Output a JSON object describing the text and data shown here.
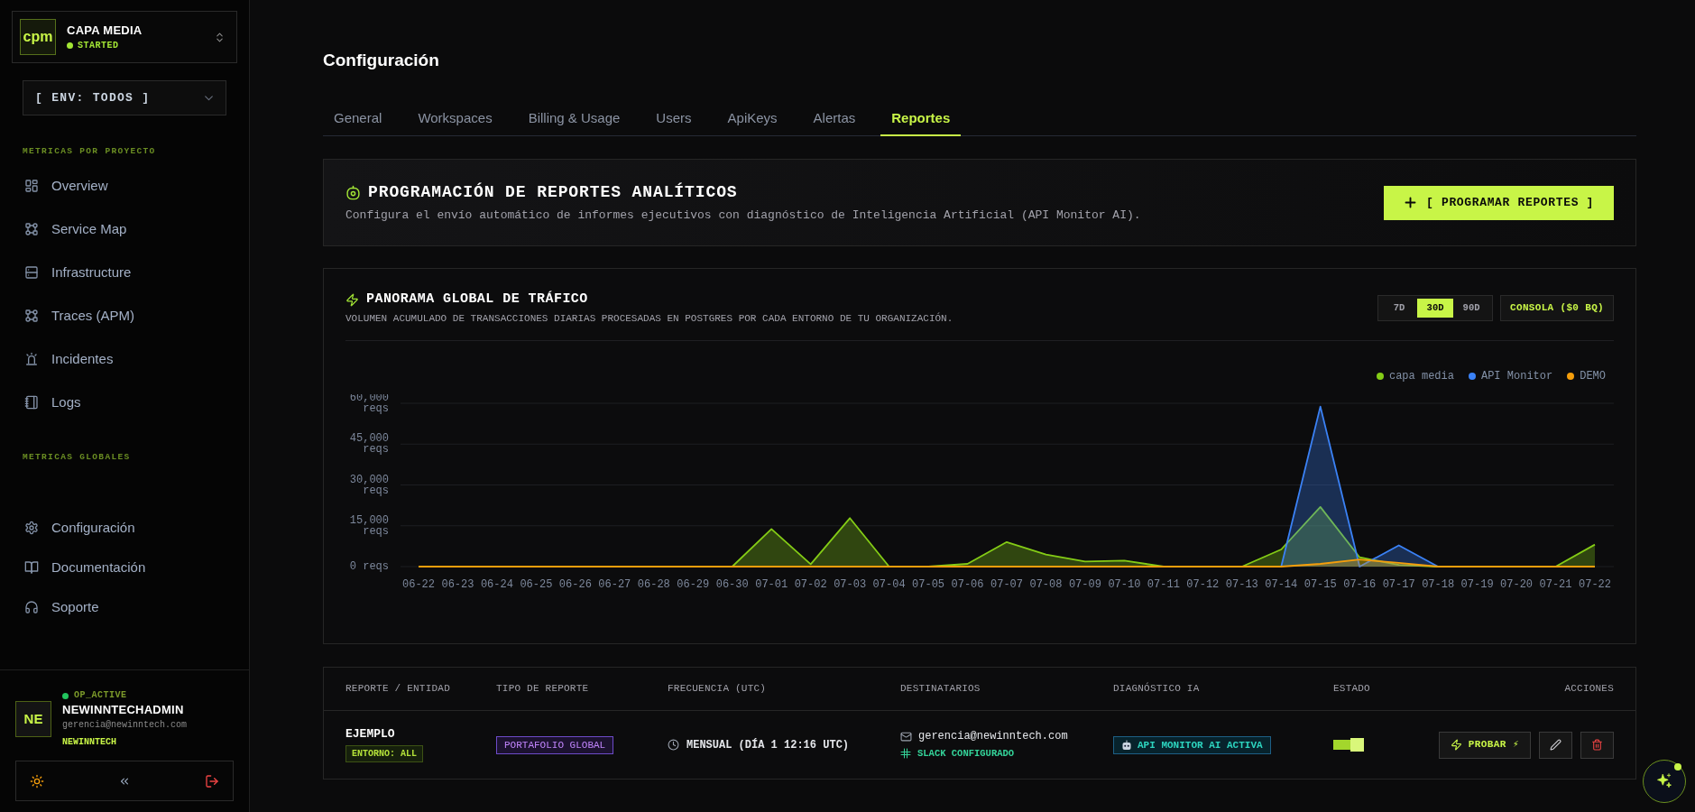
{
  "sidebar": {
    "workspace": {
      "logo": "cpm",
      "name": "CAPA MEDIA",
      "status": "STARTED"
    },
    "environment_select": {
      "value": "[ ENV: TODOS ]"
    },
    "sections": [
      {
        "title": "METRICAS POR PROYECTO",
        "items": [
          {
            "label": "Overview",
            "selected": false
          },
          {
            "label": "Service Map",
            "selected": false
          },
          {
            "label": "Infrastructure",
            "selected": false
          },
          {
            "label": "Traces (APM)",
            "selected": false
          },
          {
            "label": "Incidentes",
            "selected": false
          },
          {
            "label": "Logs",
            "selected": false
          }
        ]
      },
      {
        "title": "METRICAS GLOBALES"
      }
    ],
    "footer_items": [
      {
        "label": "Configuración",
        "selected": false
      },
      {
        "label": "Documentación",
        "selected": false
      },
      {
        "label": "Soporte",
        "selected": false
      }
    ],
    "user": {
      "status": "OP_ACTIVE",
      "initials": "NE",
      "name": "NEWINNTECHADMIN",
      "email": "gerencia@newinntech.com",
      "organization": "NEWINNTECH"
    }
  },
  "page": {
    "title": "Configuración",
    "tabs": [
      {
        "label": "General",
        "selected": false
      },
      {
        "label": "Workspaces",
        "selected": false
      },
      {
        "label": "Billing & Usage",
        "selected": false
      },
      {
        "label": "Users",
        "selected": false
      },
      {
        "label": "ApiKeys",
        "selected": false
      },
      {
        "label": "Alertas",
        "selected": false
      },
      {
        "label": "Reportes",
        "selected": true
      }
    ]
  },
  "report_scheduler": {
    "title": "PROGRAMACIÓN DE REPORTES ANALÍTICOS",
    "description": "Configura el envío automático de informes ejecutivos con diagnóstico de Inteligencia Artificial (API Monitor AI).",
    "button": "[ PROGRAMAR REPORTES ]"
  },
  "traffic_panel": {
    "title": "PANORAMA GLOBAL DE TRÁFICO",
    "subtitle": "VOLUMEN ACUMULADO DE TRANSACCIONES DIARIAS PROCESADAS EN POSTGRES POR CADA ENTORNO DE TU ORGANIZACIÓN.",
    "ranges": [
      {
        "label": "7D",
        "selected": false
      },
      {
        "label": "30D",
        "selected": true
      },
      {
        "label": "90D",
        "selected": false
      }
    ],
    "console_button": "CONSOLA ($0 BQ)",
    "chart_data": {
      "type": "area",
      "categories": [
        "06-22",
        "06-23",
        "06-24",
        "06-25",
        "06-26",
        "06-27",
        "06-28",
        "06-29",
        "06-30",
        "07-01",
        "07-02",
        "07-03",
        "07-04",
        "07-05",
        "07-06",
        "07-07",
        "07-08",
        "07-09",
        "07-10",
        "07-11",
        "07-12",
        "07-13",
        "07-14",
        "07-15",
        "07-16",
        "07-17",
        "07-18",
        "07-19",
        "07-20",
        "07-21",
        "07-22"
      ],
      "series": [
        {
          "name": "capa media",
          "color": "#84cc16",
          "values": [
            null,
            null,
            null,
            null,
            null,
            null,
            null,
            null,
            0,
            13800,
            900,
            17800,
            0,
            0,
            1000,
            9000,
            4400,
            1900,
            2200,
            0,
            null,
            0,
            6300,
            21900,
            3400,
            600,
            0,
            null,
            null,
            0,
            8100
          ]
        },
        {
          "name": "API Monitor",
          "color": "#3b82f6",
          "values": [
            null,
            null,
            null,
            null,
            null,
            null,
            null,
            null,
            null,
            null,
            null,
            null,
            null,
            null,
            null,
            null,
            null,
            null,
            null,
            null,
            null,
            null,
            0,
            58800,
            0,
            7800,
            0,
            null,
            null,
            null,
            null
          ]
        },
        {
          "name": "DEMO",
          "color": "#f59e0b",
          "values": [
            0,
            0,
            0,
            0,
            0,
            0,
            0,
            0,
            0,
            0,
            0,
            0,
            0,
            0,
            0,
            0,
            0,
            0,
            0,
            0,
            0,
            0,
            0,
            1000,
            2600,
            1400,
            0,
            0,
            0,
            0,
            0
          ]
        }
      ],
      "ylim": [
        0,
        60000
      ],
      "yticks": [
        {
          "value": 0,
          "label": "0 reqs"
        },
        {
          "value": 15000,
          "label": "15,000 reqs"
        },
        {
          "value": 30000,
          "label": "30,000 reqs"
        },
        {
          "value": 45000,
          "label": "45,000 reqs"
        },
        {
          "value": 60000,
          "label": "60,000 reqs"
        }
      ],
      "grid": true
    }
  },
  "reports_table": {
    "columns": [
      "REPORTE / ENTIDAD",
      "TIPO DE REPORTE",
      "FRECUENCIA (UTC)",
      "DESTINATARIOS",
      "DIAGNÓSTICO IA",
      "ESTADO",
      "ACCIONES"
    ],
    "rows": [
      {
        "name": "EJEMPLO",
        "environment": "ENTORNO: ALL",
        "type": "PORTAFOLIO GLOBAL",
        "frequency": "MENSUAL (DÍA 1 12:16 UTC)",
        "email": "gerencia@newinntech.com",
        "slack": "SLACK CONFIGURADO",
        "diagnosis": "API MONITOR AI ACTIVA",
        "active": true,
        "actions": [
          {
            "kind": "test",
            "label": "PROBAR ⚡"
          },
          {
            "kind": "edit"
          },
          {
            "kind": "delete"
          }
        ]
      }
    ]
  }
}
